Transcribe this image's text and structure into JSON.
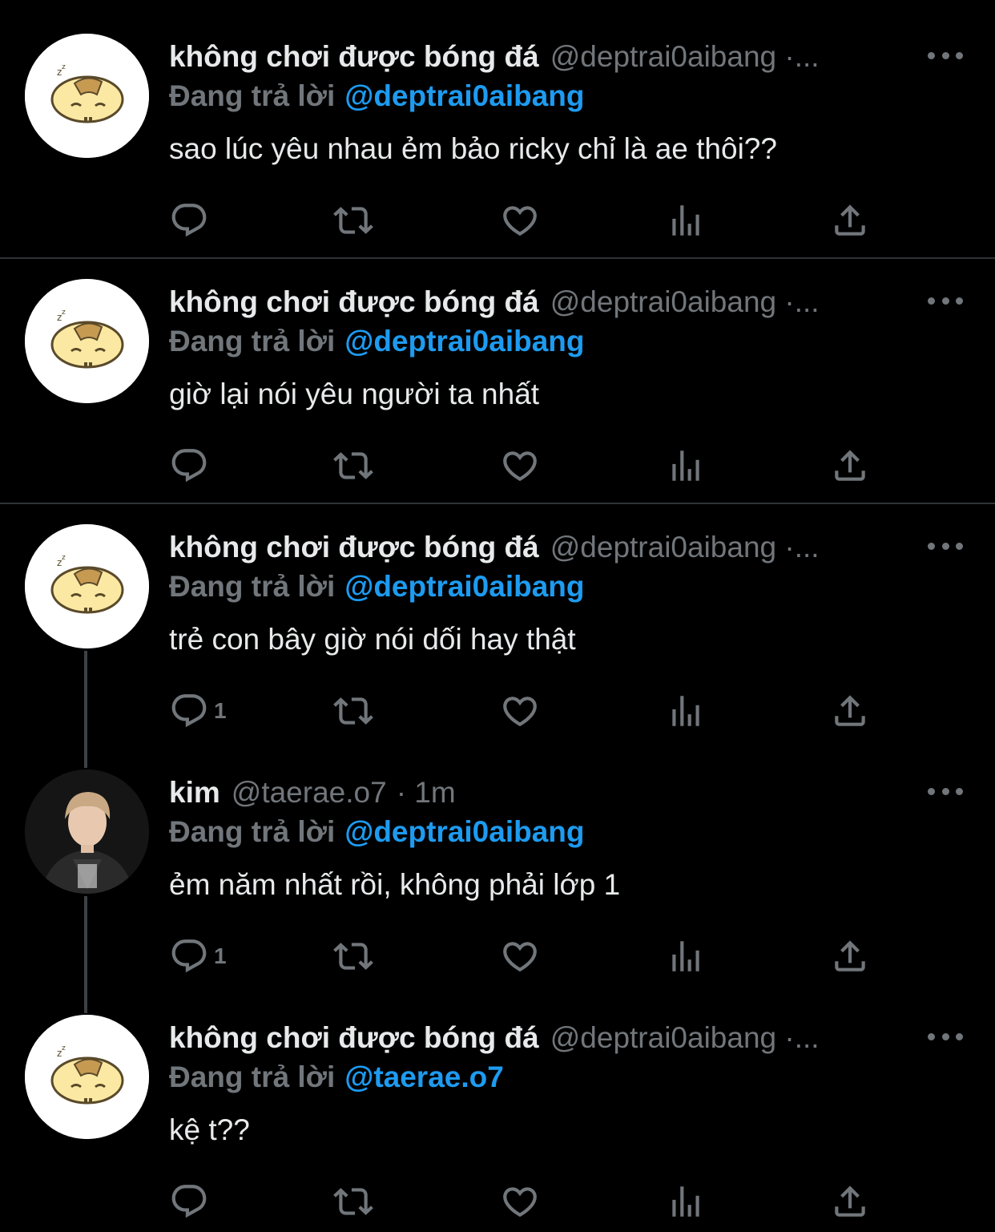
{
  "tweets": [
    {
      "name": "không chơi được bóng đá",
      "handle": "@deptrai0aibang ·...",
      "time": "",
      "reply_prefix": "Đang trả lời",
      "reply_to": "@deptrai0aibang",
      "text": "sao lúc yêu nhau ẻm bảo ricky chỉ là ae thôi??",
      "reply_count": ""
    },
    {
      "name": "không chơi được bóng đá",
      "handle": "@deptrai0aibang ·...",
      "time": "",
      "reply_prefix": "Đang trả lời",
      "reply_to": "@deptrai0aibang",
      "text": "giờ lại nói yêu người ta nhất",
      "reply_count": ""
    },
    {
      "name": "không chơi được bóng đá",
      "handle": "@deptrai0aibang ·...",
      "time": "",
      "reply_prefix": "Đang trả lời",
      "reply_to": "@deptrai0aibang",
      "text": "trẻ con bây giờ nói dối hay thật",
      "reply_count": "1"
    },
    {
      "name": "kim",
      "handle": "@taerae.o7",
      "time": "· 1m",
      "reply_prefix": "Đang trả lời",
      "reply_to": "@deptrai0aibang",
      "text": "ẻm năm nhất rồi, không phải lớp 1",
      "reply_count": "1"
    },
    {
      "name": "không chơi được bóng đá",
      "handle": "@deptrai0aibang ·...",
      "time": "",
      "reply_prefix": "Đang trả lời",
      "reply_to": "@taerae.o7",
      "text": "kệ t??",
      "reply_count": ""
    }
  ],
  "icons": [
    "reply-icon",
    "retweet-icon",
    "like-icon",
    "views-icon",
    "share-icon",
    "more-icon"
  ],
  "colors": {
    "background": "#000000",
    "text": "#e7e9ea",
    "muted": "#71767b",
    "mention": "#1d9bf0",
    "divider": "#2f3336"
  }
}
